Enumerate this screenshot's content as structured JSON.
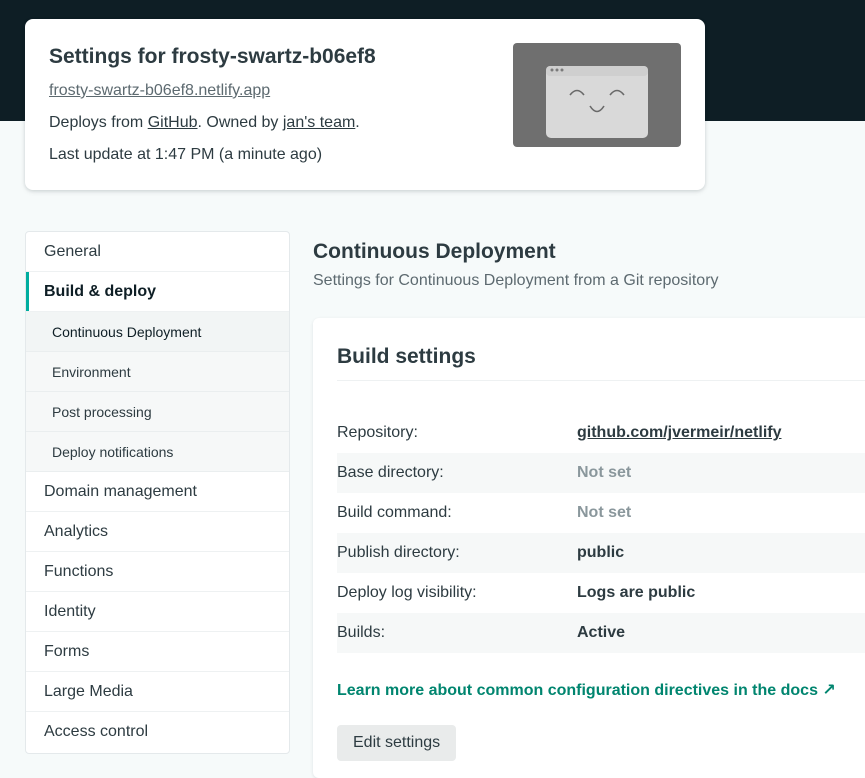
{
  "site": {
    "title": "Settings for frosty-swartz-b06ef8",
    "url": "frosty-swartz-b06ef8.netlify.app",
    "deploys_prefix": "Deploys from ",
    "deploys_source": "GitHub",
    "owned_text": ". Owned by ",
    "owner": "jan's team",
    "owned_suffix": ".",
    "last_update": "Last update at 1:47 PM (a minute ago)",
    "thumbnail_icon": "smiley-browser-icon"
  },
  "sidebar": {
    "items": [
      {
        "label": "General"
      },
      {
        "label": "Build & deploy",
        "active": true
      },
      {
        "label": "Domain management"
      },
      {
        "label": "Analytics"
      },
      {
        "label": "Functions"
      },
      {
        "label": "Identity"
      },
      {
        "label": "Forms"
      },
      {
        "label": "Large Media"
      },
      {
        "label": "Access control"
      }
    ],
    "subitems": [
      {
        "label": "Continuous Deployment",
        "active": true
      },
      {
        "label": "Environment"
      },
      {
        "label": "Post processing"
      },
      {
        "label": "Deploy notifications"
      }
    ]
  },
  "main": {
    "title": "Continuous Deployment",
    "subtitle": "Settings for Continuous Deployment from a Git repository",
    "panel": {
      "title": "Build settings",
      "rows": [
        {
          "label": "Repository:",
          "value": "github.com/jvermeir/netlify"
        },
        {
          "label": "Base directory:",
          "value": "Not set"
        },
        {
          "label": "Build command:",
          "value": "Not set"
        },
        {
          "label": "Publish directory:",
          "value": "public"
        },
        {
          "label": "Deploy log visibility:",
          "value": "Logs are public"
        },
        {
          "label": "Builds:",
          "value": "Active"
        }
      ],
      "docs_link": "Learn more about common configuration directives in the docs ↗",
      "edit_button": "Edit settings"
    }
  },
  "colors": {
    "accent": "#00ad9f",
    "link": "#00856f",
    "header_band": "#0e1e25"
  }
}
